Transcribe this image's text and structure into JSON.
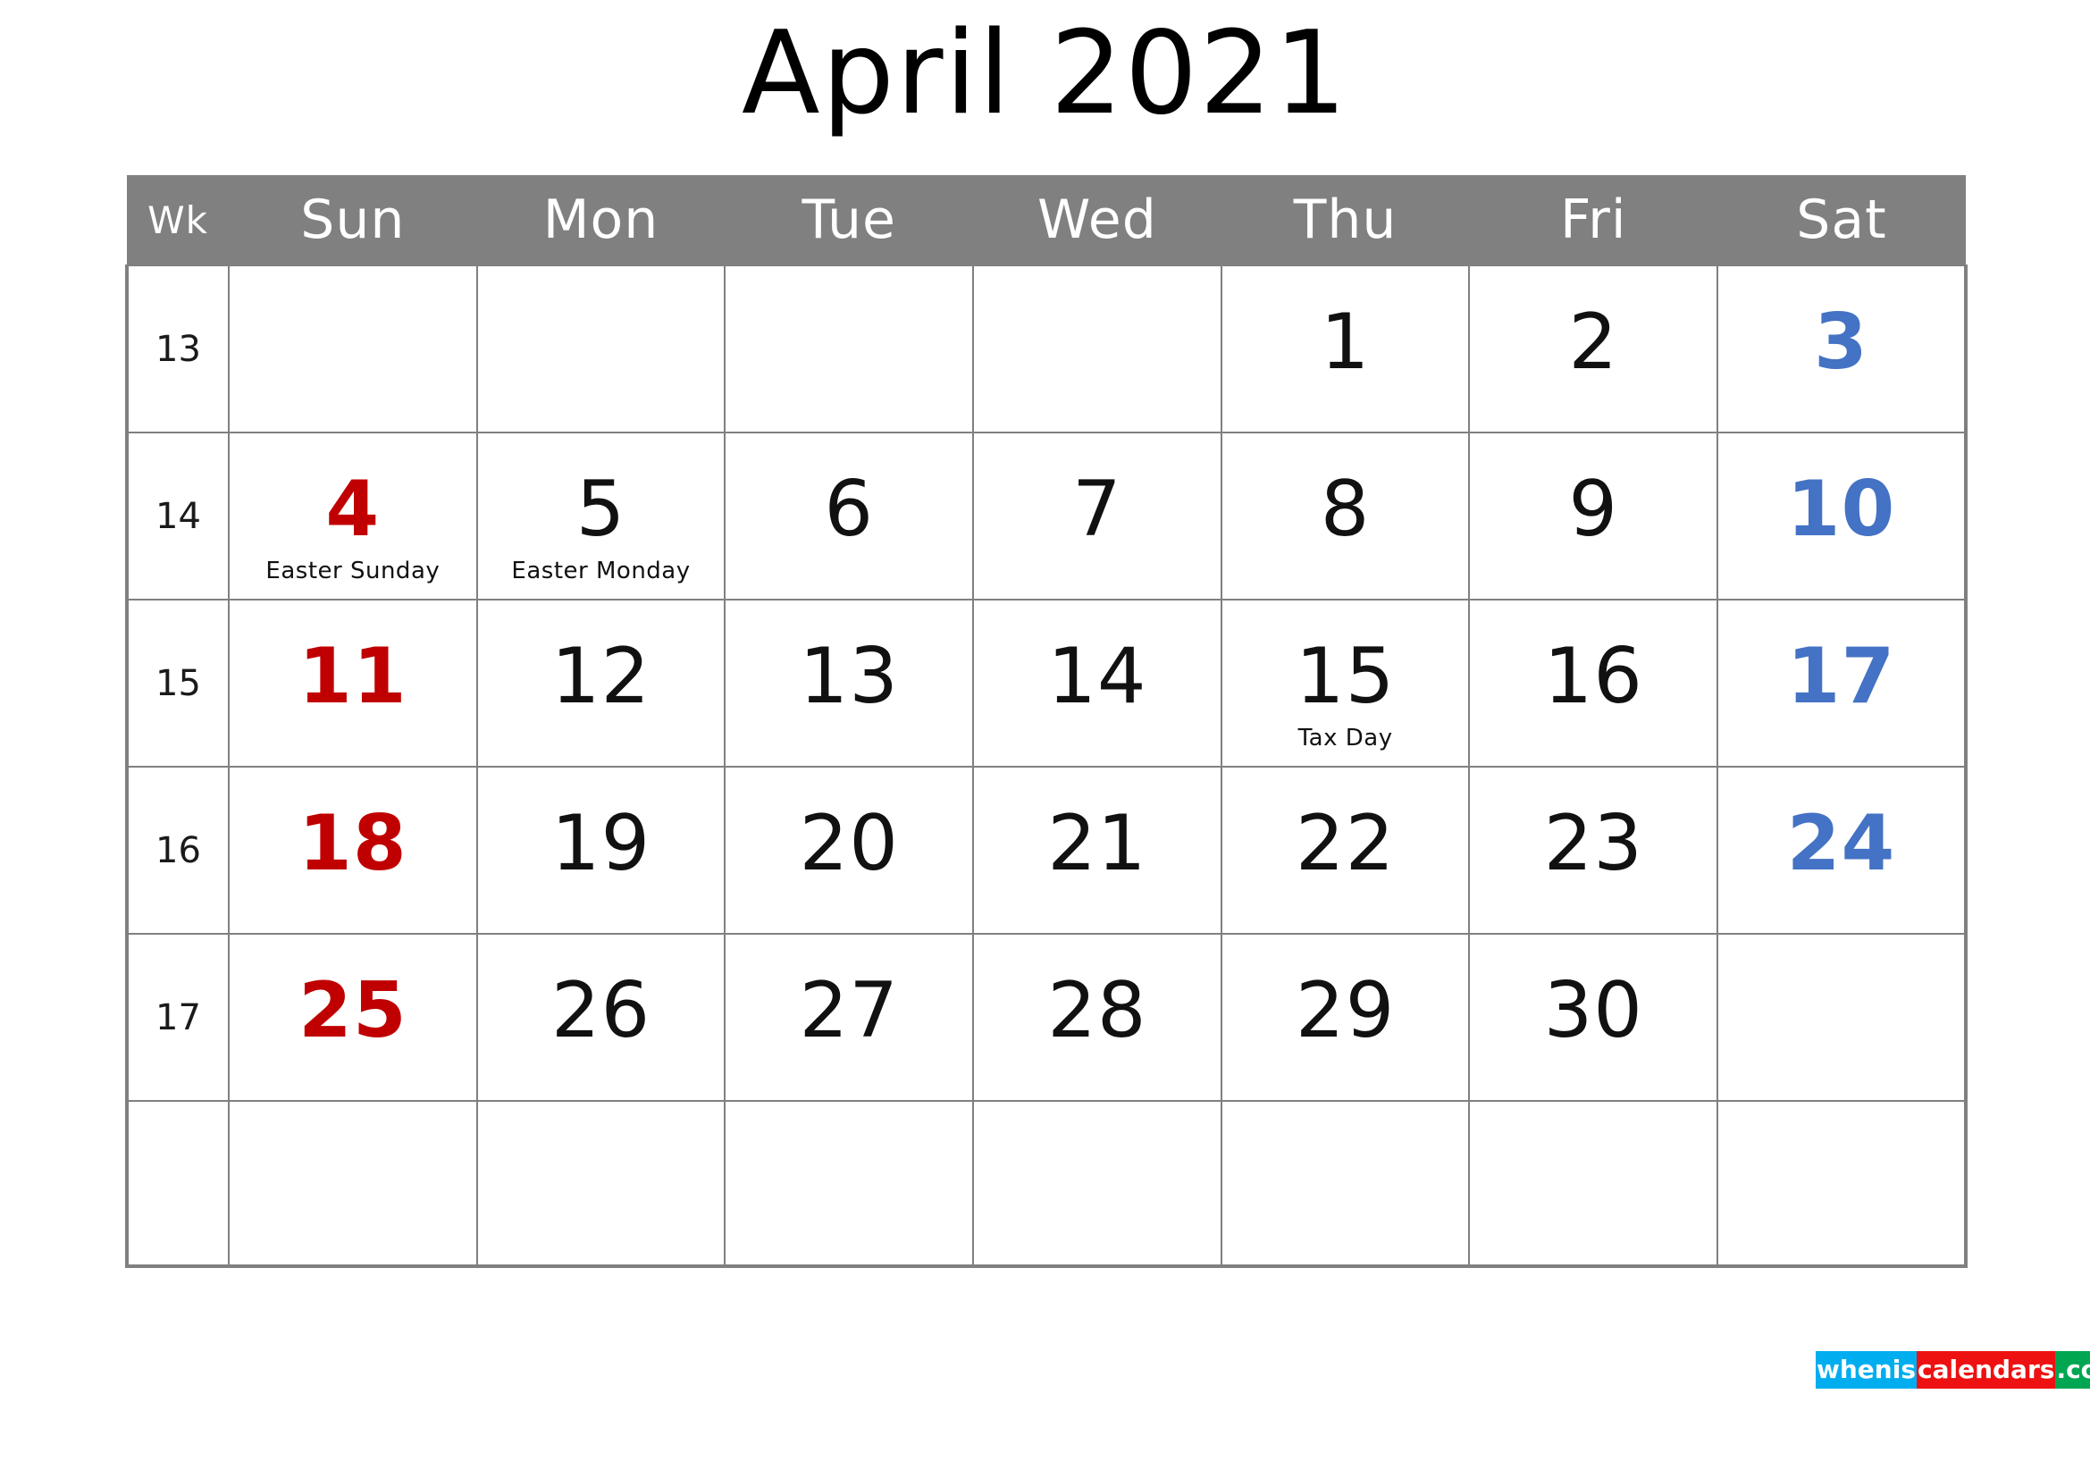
{
  "title": "April 2021",
  "colors": {
    "header_bg": "#808080",
    "grid": "#808080",
    "sunday": "#C00000",
    "saturday": "#4472C4",
    "weekday": "#111111",
    "watermark_blue": "#00AEEF",
    "watermark_red": "#EE1111",
    "watermark_green": "#00A651"
  },
  "headers": {
    "week": "Wk",
    "days": [
      "Sun",
      "Mon",
      "Tue",
      "Wed",
      "Thu",
      "Fri",
      "Sat"
    ]
  },
  "weeks": [
    {
      "week_number": "13",
      "days": [
        {
          "num": "",
          "kind": "sun",
          "holiday": ""
        },
        {
          "num": "",
          "kind": "weekday",
          "holiday": ""
        },
        {
          "num": "",
          "kind": "weekday",
          "holiday": ""
        },
        {
          "num": "",
          "kind": "weekday",
          "holiday": ""
        },
        {
          "num": "1",
          "kind": "weekday",
          "holiday": ""
        },
        {
          "num": "2",
          "kind": "weekday",
          "holiday": ""
        },
        {
          "num": "3",
          "kind": "sat",
          "holiday": ""
        }
      ]
    },
    {
      "week_number": "14",
      "days": [
        {
          "num": "4",
          "kind": "sun",
          "holiday": "Easter Sunday"
        },
        {
          "num": "5",
          "kind": "weekday",
          "holiday": "Easter Monday"
        },
        {
          "num": "6",
          "kind": "weekday",
          "holiday": ""
        },
        {
          "num": "7",
          "kind": "weekday",
          "holiday": ""
        },
        {
          "num": "8",
          "kind": "weekday",
          "holiday": ""
        },
        {
          "num": "9",
          "kind": "weekday",
          "holiday": ""
        },
        {
          "num": "10",
          "kind": "sat",
          "holiday": ""
        }
      ]
    },
    {
      "week_number": "15",
      "days": [
        {
          "num": "11",
          "kind": "sun",
          "holiday": ""
        },
        {
          "num": "12",
          "kind": "weekday",
          "holiday": ""
        },
        {
          "num": "13",
          "kind": "weekday",
          "holiday": ""
        },
        {
          "num": "14",
          "kind": "weekday",
          "holiday": ""
        },
        {
          "num": "15",
          "kind": "weekday",
          "holiday": "Tax Day"
        },
        {
          "num": "16",
          "kind": "weekday",
          "holiday": ""
        },
        {
          "num": "17",
          "kind": "sat",
          "holiday": ""
        }
      ]
    },
    {
      "week_number": "16",
      "days": [
        {
          "num": "18",
          "kind": "sun",
          "holiday": ""
        },
        {
          "num": "19",
          "kind": "weekday",
          "holiday": ""
        },
        {
          "num": "20",
          "kind": "weekday",
          "holiday": ""
        },
        {
          "num": "21",
          "kind": "weekday",
          "holiday": ""
        },
        {
          "num": "22",
          "kind": "weekday",
          "holiday": ""
        },
        {
          "num": "23",
          "kind": "weekday",
          "holiday": ""
        },
        {
          "num": "24",
          "kind": "sat",
          "holiday": ""
        }
      ]
    },
    {
      "week_number": "17",
      "days": [
        {
          "num": "25",
          "kind": "sun",
          "holiday": ""
        },
        {
          "num": "26",
          "kind": "weekday",
          "holiday": ""
        },
        {
          "num": "27",
          "kind": "weekday",
          "holiday": ""
        },
        {
          "num": "28",
          "kind": "weekday",
          "holiday": ""
        },
        {
          "num": "29",
          "kind": "weekday",
          "holiday": ""
        },
        {
          "num": "30",
          "kind": "weekday",
          "holiday": ""
        },
        {
          "num": "",
          "kind": "sat",
          "holiday": ""
        }
      ]
    },
    {
      "week_number": "",
      "days": [
        {
          "num": "",
          "kind": "sun",
          "holiday": ""
        },
        {
          "num": "",
          "kind": "weekday",
          "holiday": ""
        },
        {
          "num": "",
          "kind": "weekday",
          "holiday": ""
        },
        {
          "num": "",
          "kind": "weekday",
          "holiday": ""
        },
        {
          "num": "",
          "kind": "weekday",
          "holiday": ""
        },
        {
          "num": "",
          "kind": "weekday",
          "holiday": ""
        },
        {
          "num": "",
          "kind": "sat",
          "holiday": ""
        }
      ]
    }
  ],
  "watermark": {
    "part1": "whenis",
    "part2": "calendars",
    "part3": ".com"
  }
}
